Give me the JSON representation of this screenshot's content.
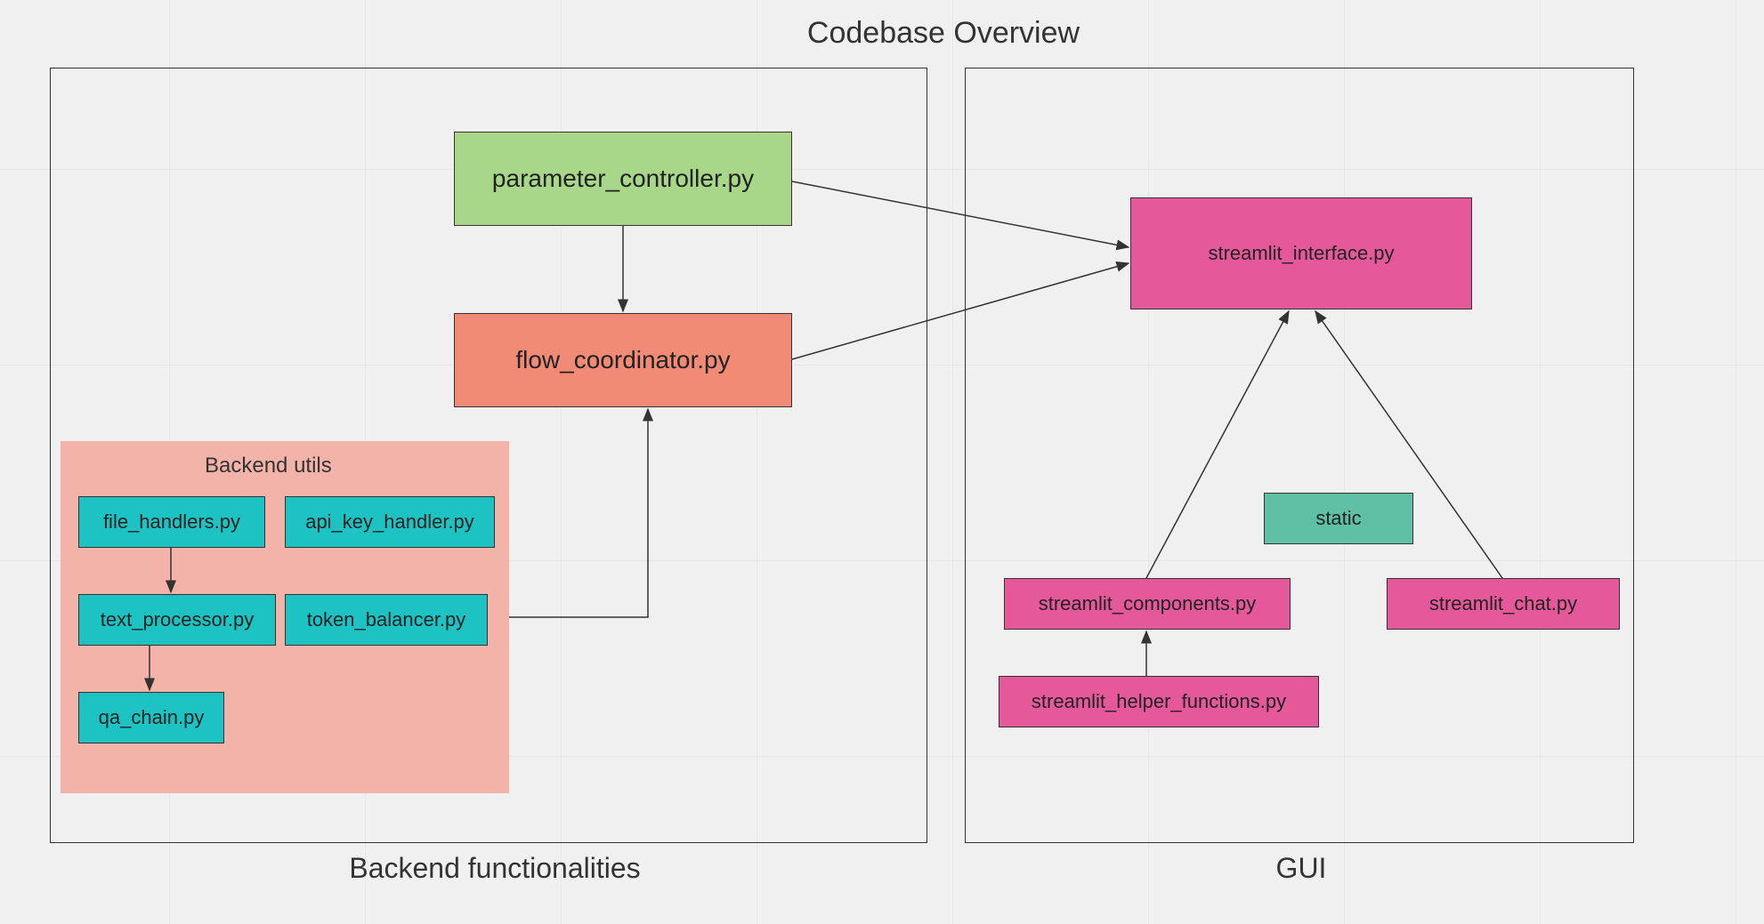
{
  "title": "Codebase Overview",
  "groups": {
    "backend": {
      "label": "Backend functionalities"
    },
    "gui": {
      "label": "GUI"
    },
    "utils": {
      "label": "Backend utils"
    }
  },
  "nodes": {
    "parameter_controller": {
      "label": "parameter_controller.py"
    },
    "flow_coordinator": {
      "label": "flow_coordinator.py"
    },
    "file_handlers": {
      "label": "file_handlers.py"
    },
    "api_key_handler": {
      "label": "api_key_handler.py"
    },
    "text_processor": {
      "label": "text_processor.py"
    },
    "token_balancer": {
      "label": "token_balancer.py"
    },
    "qa_chain": {
      "label": "qa_chain.py"
    },
    "streamlit_interface": {
      "label": "streamlit_interface.py"
    },
    "static": {
      "label": "static"
    },
    "streamlit_components": {
      "label": "streamlit_components.py"
    },
    "streamlit_chat": {
      "label": "streamlit_chat.py"
    },
    "streamlit_helper_functions": {
      "label": "streamlit_helper_functions.py"
    }
  },
  "edges": [
    {
      "from": "parameter_controller",
      "to": "flow_coordinator"
    },
    {
      "from": "utils_group",
      "to": "flow_coordinator"
    },
    {
      "from": "file_handlers",
      "to": "text_processor"
    },
    {
      "from": "text_processor",
      "to": "qa_chain"
    },
    {
      "from": "parameter_controller",
      "to": "streamlit_interface"
    },
    {
      "from": "flow_coordinator",
      "to": "streamlit_interface"
    },
    {
      "from": "streamlit_components",
      "to": "streamlit_interface"
    },
    {
      "from": "streamlit_chat",
      "to": "streamlit_interface"
    },
    {
      "from": "streamlit_helper_functions",
      "to": "streamlit_components"
    }
  ],
  "colors": {
    "green": "#a8d78a",
    "salmon": "#f28b76",
    "cyan": "#1dc3c2",
    "pink": "#e5599b",
    "teal": "#5fc0a6",
    "subgroup_bg": "#f3b3a8"
  }
}
